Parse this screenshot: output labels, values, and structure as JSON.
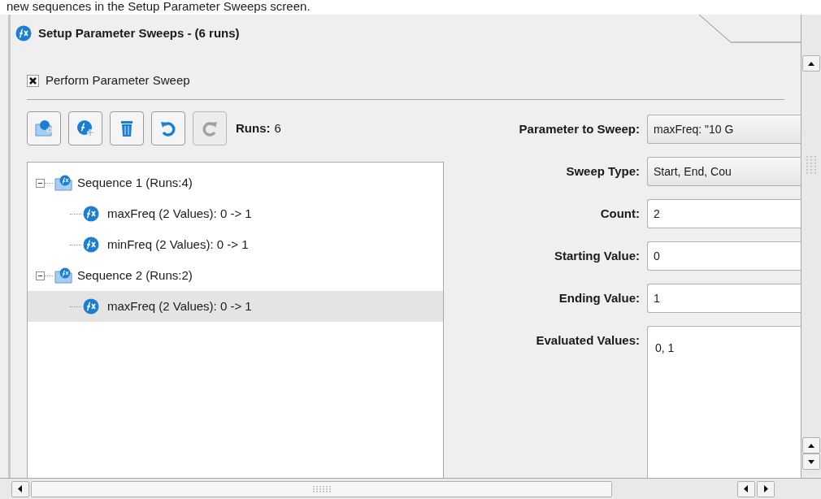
{
  "caption": "new sequences in the Setup Parameter Sweeps screen.",
  "title": "Setup Parameter Sweeps - (6 runs)",
  "perform_sweep": {
    "label": "Perform Parameter Sweep",
    "checked": true
  },
  "toolbar": {
    "buttons": [
      {
        "kind": "add-sequence",
        "disabled": false
      },
      {
        "kind": "add-parameter",
        "disabled": false
      },
      {
        "kind": "delete",
        "disabled": false
      },
      {
        "kind": "undo",
        "disabled": false
      },
      {
        "kind": "redo",
        "disabled": true
      }
    ],
    "runs_label": "Runs:",
    "runs_value": "6"
  },
  "tree": [
    {
      "label": "Sequence 1 (Runs:4)",
      "expanded": true,
      "selected": false,
      "children": [
        {
          "label": "maxFreq (2 Values): 0 -> 1",
          "selected": false
        },
        {
          "label": "minFreq (2 Values): 0 -> 1",
          "selected": false
        }
      ]
    },
    {
      "label": "Sequence 2 (Runs:2)",
      "expanded": true,
      "selected": false,
      "children": [
        {
          "label": "maxFreq (2 Values): 0 -> 1",
          "selected": true
        }
      ]
    }
  ],
  "form": [
    {
      "kind": "dropdown",
      "label": "Parameter to Sweep:",
      "value": "maxFreq: \"10 G"
    },
    {
      "kind": "dropdown",
      "label": "Sweep Type:",
      "value": "Start, End, Cou"
    },
    {
      "kind": "input",
      "label": "Count:",
      "value": "2"
    },
    {
      "kind": "input",
      "label": "Starting Value:",
      "value": "0"
    },
    {
      "kind": "input",
      "label": "Ending Value:",
      "value": "1"
    },
    {
      "kind": "textarea",
      "label": "Evaluated Values:",
      "value": "0, 1"
    }
  ]
}
